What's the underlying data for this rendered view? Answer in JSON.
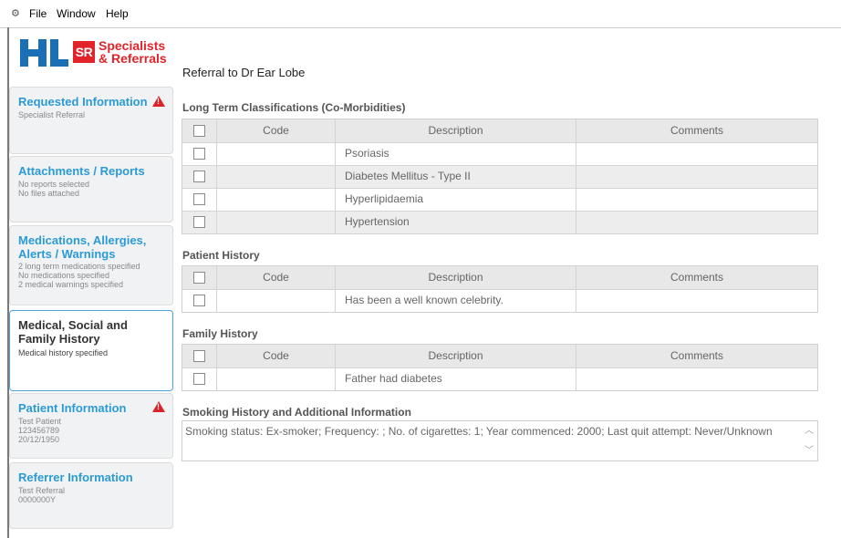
{
  "menubar": {
    "items": [
      "File",
      "Window",
      "Help"
    ]
  },
  "header": {
    "logo_hl": "HL",
    "logo_sr": "SR",
    "logo_sr_line1": "Specialists",
    "logo_sr_line2": "& Referrals",
    "title": "Referral to Dr Ear Lobe"
  },
  "sidebar": {
    "cards": [
      {
        "title": "Requested Information",
        "lines": [
          "Specialist Referral"
        ],
        "warning": true
      },
      {
        "title": "Attachments / Reports",
        "lines": [
          "No reports selected",
          "No files attached"
        ],
        "warning": false
      },
      {
        "title": "Medications, Allergies, Alerts / Warnings",
        "lines": [
          "2 long term medications specified",
          "No medications specified",
          "2 medical warnings specified"
        ],
        "warning": false
      },
      {
        "title": "Medical, Social and Family History",
        "lines": [
          "Medical history specified"
        ],
        "warning": false,
        "active": true
      },
      {
        "title": "Patient Information",
        "lines": [
          "Test Patient",
          "123456789",
          "20/12/1950"
        ],
        "warning": true
      },
      {
        "title": "Referrer Information",
        "lines": [
          "Test Referral",
          "0000000Y"
        ],
        "warning": false
      }
    ]
  },
  "columns": {
    "code": "Code",
    "description": "Description",
    "comments": "Comments"
  },
  "sections": {
    "long_term": {
      "label": "Long Term Classifications (Co-Morbidities)",
      "rows": [
        "Psoriasis",
        "Diabetes Mellitus - Type II",
        "Hyperlipidaemia",
        "Hypertension"
      ]
    },
    "patient_history": {
      "label": "Patient History",
      "rows": [
        "Has been a well known celebrity."
      ]
    },
    "family_history": {
      "label": "Family History",
      "rows": [
        "Father had diabetes"
      ]
    },
    "smoking": {
      "label": "Smoking History and Additional Information",
      "text": "Smoking status: Ex-smoker; Frequency: ; No. of cigarettes: 1; Year commenced: 2000; Last quit attempt: Never/Unknown"
    }
  },
  "colors": {
    "accent_blue": "#2b9bd6",
    "brand_red": "#e2232a",
    "hl_blue": "#1a6fb5",
    "warning_red": "#d9242a"
  }
}
